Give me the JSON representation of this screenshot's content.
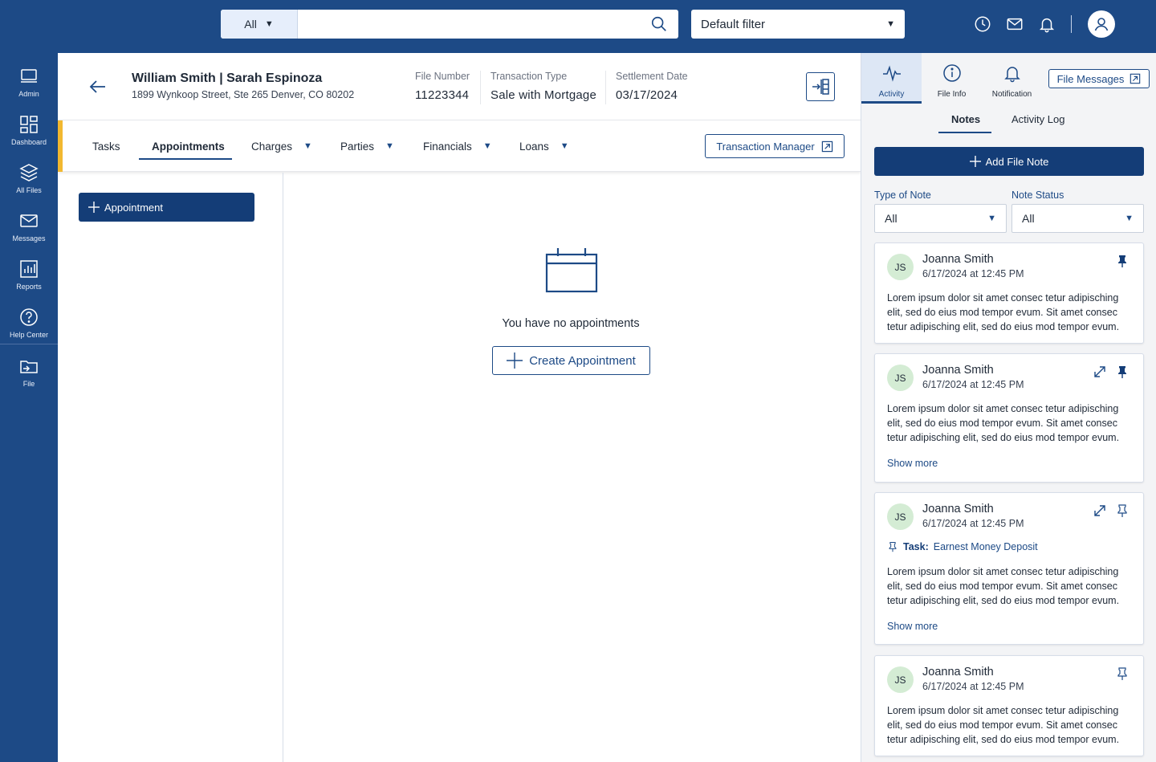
{
  "topbar": {
    "scope_label": "All",
    "search_placeholder": "",
    "filter_value": "Default filter"
  },
  "sidebar": {
    "items": [
      {
        "label": "Admin",
        "icon": "monitor-icon"
      },
      {
        "label": "Dashboard",
        "icon": "dashboard-icon"
      },
      {
        "label": "All Files",
        "icon": "layers-icon"
      },
      {
        "label": "Messages",
        "icon": "mail-icon"
      },
      {
        "label": "Reports",
        "icon": "reports-icon"
      },
      {
        "label": "Help Center",
        "icon": "help-icon"
      },
      {
        "label": "File",
        "icon": "folder-icon"
      }
    ]
  },
  "header": {
    "names": "William Smith | Sarah Espinoza",
    "address": "1899 Wynkoop Street, Ste 265 Denver, CO 80202",
    "file_number_label": "File Number",
    "file_number": "11223344",
    "transaction_type_label": "Transaction Type",
    "transaction_type": "Sale with Mortgage",
    "settlement_date_label": "Settlement Date",
    "settlement_date": "03/17/2024"
  },
  "tabs": {
    "items": [
      {
        "label": "Tasks"
      },
      {
        "label": "Appointments"
      },
      {
        "label": "Charges"
      },
      {
        "label": "Parties"
      },
      {
        "label": "Financials"
      },
      {
        "label": "Loans"
      }
    ],
    "transaction_manager": "Transaction Manager"
  },
  "left": {
    "appointment_button": "Appointment"
  },
  "empty": {
    "message": "You have no appointments",
    "create_button": "Create Appointment"
  },
  "right": {
    "tabs": [
      {
        "label": "Activity"
      },
      {
        "label": "File Info"
      },
      {
        "label": "Notification"
      }
    ],
    "file_messages": "File Messages",
    "subtabs": {
      "notes": "Notes",
      "activity_log": "Activity Log"
    },
    "add_note": "Add File Note",
    "type_label": "Type of Note",
    "type_value": "All",
    "status_label": "Note Status",
    "status_value": "All",
    "notes": [
      {
        "initials": "JS",
        "name": "Joanna Smith",
        "date": "6/17/2024 at 12:45 PM",
        "body": "Lorem ipsum dolor sit amet consec tetur adipisching elit, sed do eius mod tempor evum. Sit amet consec tetur adipisching elit, sed do eius mod tempor evum."
      },
      {
        "initials": "JS",
        "name": "Joanna Smith",
        "date": "6/17/2024 at 12:45 PM",
        "body": "Lorem ipsum dolor sit amet consec tetur adipisching elit, sed do eius mod tempor evum. Sit amet consec tetur adipisching elit, sed do eius mod tempor evum.",
        "more": "Show more"
      },
      {
        "initials": "JS",
        "name": "Joanna Smith",
        "date": "6/17/2024 at 12:45 PM",
        "task_label": "Task:",
        "task_name": "Earnest Money Deposit",
        "body": "Lorem ipsum dolor sit amet consec tetur adipisching elit, sed do eius mod tempor evum. Sit amet consec tetur adipisching elit, sed do eius mod tempor evum.",
        "more": "Show more"
      },
      {
        "initials": "JS",
        "name": "Joanna Smith",
        "date": "6/17/2024 at 12:45 PM",
        "body": "Lorem ipsum dolor sit amet consec tetur adipisching elit, sed do eius mod tempor evum. Sit amet consec tetur adipisching elit, sed do eius mod tempor evum."
      }
    ]
  },
  "colors": {
    "primary": "#1d4a86",
    "button": "#143d77",
    "accent": "#f2b830",
    "avatar_bg": "#d4ecd4"
  }
}
